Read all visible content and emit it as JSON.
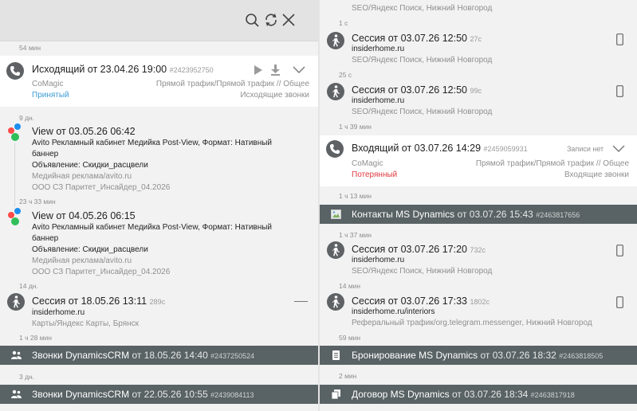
{
  "left": {
    "gaps": [
      "54 мин",
      "9 дн.",
      "23 ч 33 мин",
      "14 дн.",
      "1 ч 28 мин",
      "3 дн."
    ],
    "call1": {
      "title": "Исходящий от 23.04.26 19:00",
      "id": "#2423952750",
      "provider": "CoMagic",
      "status": "Принятый",
      "traffic": "Прямой трафик/Прямой трафик // Общее",
      "direction": "Исходящие звонки"
    },
    "view1": {
      "title": "View от 03.05.26 06:42",
      "line1": "Avito Рекламный кабинет Медийка Post-View, Формат: Нативный",
      "line2": "баннер",
      "line3": "Объявление: Скидки_расцвели",
      "line4": "Медийная реклама/avito.ru",
      "line5": "ООО СЗ Паритет_Инсайдер_04.2026"
    },
    "view2": {
      "title": "View от 04.05.26 06:15",
      "line1": "Avito Рекламный кабинет Медийка Post-View, Формат: Нативный",
      "line2": "баннер",
      "line3": "Объявление: Скидки_расцвели",
      "line4": "Медийная реклама/avito.ru",
      "line5": "ООО СЗ Паритет_Инсайдер_04.2026"
    },
    "session1": {
      "title": "Сессия от 18.05.26 13:11",
      "duration": "289с",
      "site": "insiderhome.ru",
      "source": "Карты/Яндекс Карты, Брянск"
    },
    "bar1": {
      "name": "Звонки DynamicsCRM",
      "date": "от 18.05.26 14:40",
      "id": "#2437250524"
    },
    "bar2": {
      "name": "Звонки DynamicsCRM",
      "date": "от 22.05.26 10:55",
      "id": "#2439084113"
    }
  },
  "right": {
    "top_source": "SEO/Яндекс Поиск, Нижний Новгород",
    "gaps": [
      "1 с",
      "25 с",
      "1 ч 39 мин",
      "1 ч 13 мин",
      "1 ч 37 мин",
      "14 мин",
      "59 мин",
      "2 мин"
    ],
    "session1": {
      "title": "Сессия от 03.07.26 12:50",
      "duration": "27с",
      "site": "insiderhome.ru",
      "source": "SEO/Яндекс Поиск, Нижний Новгород"
    },
    "session2": {
      "title": "Сессия от 03.07.26 12:50",
      "duration": "99с",
      "site": "insiderhome.ru",
      "source": "SEO/Яндекс Поиск, Нижний Новгород"
    },
    "call1": {
      "title": "Входящий от 03.07.26 14:29",
      "id": "#2459059931",
      "no_records": "Записи нет",
      "provider": "CoMagic",
      "status": "Потерянный",
      "traffic": "Прямой трафик/Прямой трафик // Общее",
      "direction": "Входящие звонки"
    },
    "bar1": {
      "name": "Контакты MS Dynamics",
      "date": "от 03.07.26 15:43",
      "id": "#2463817656"
    },
    "session3": {
      "title": "Сессия от 03.07.26 17:20",
      "duration": "732с",
      "site": "insiderhome.ru",
      "source": "SEO/Яндекс Поиск, Нижний Новгород"
    },
    "session4": {
      "title": "Сессия от 03.07.26 17:33",
      "duration": "1802с",
      "site": "insiderhome.ru/interiors",
      "source": "Реферальный трафик/org.telegram.messenger, Нижний Новгород"
    },
    "bar2": {
      "name": "Бронирование MS Dynamics",
      "date": "от 03.07.26 18:32",
      "id": "#2463818505"
    },
    "bar3": {
      "name": "Договор MS Dynamics",
      "date": "от 03.07.26 18:34",
      "id": "#2463817918"
    }
  },
  "colors": {
    "accent_blue": "#3d9bd6",
    "lost_red": "#e0383e",
    "bar_bg": "#596264"
  },
  "icons": [
    "search-icon",
    "refresh-icon",
    "close-icon",
    "phone-icon",
    "play-icon",
    "download-icon",
    "chevron-down-icon",
    "pedestrian-icon",
    "mobile-icon",
    "users-icon",
    "document-icon",
    "image-icon"
  ]
}
